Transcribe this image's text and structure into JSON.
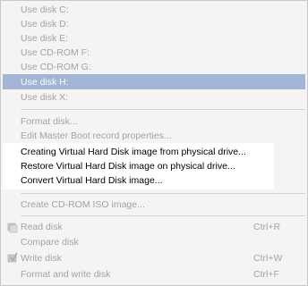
{
  "menu": {
    "disk_items": [
      "Use disk C:",
      "Use disk D:",
      "Use disk E:",
      "Use CD-ROM F:",
      "Use CD-ROM G:",
      "Use disk H:",
      "Use disk X:"
    ],
    "format_disk": "Format disk...",
    "edit_mbr": "Edit Master Boot record properties...",
    "create_vhd": "Creating Virtual Hard Disk image from physical drive...",
    "restore_vhd": "Restore Virtual Hard Disk image on physical drive...",
    "convert_vhd": "Convert Virtual Hard Disk image...",
    "create_iso": "Create CD-ROM ISO image...",
    "read_disk": "Read disk",
    "read_disk_shortcut": "Ctrl+R",
    "compare_disk": "Compare disk",
    "write_disk": "Write disk",
    "write_disk_shortcut": "Ctrl+W",
    "format_write_disk": "Format and write disk",
    "format_write_shortcut": "Ctrl+F"
  },
  "colors": {
    "highlight": "#a2b5d6",
    "disabled_text": "#a3a3a3",
    "enabled_text": "#000000"
  },
  "icons": {
    "read_disk": "read-disk-icon",
    "write_disk": "write-disk-icon"
  }
}
